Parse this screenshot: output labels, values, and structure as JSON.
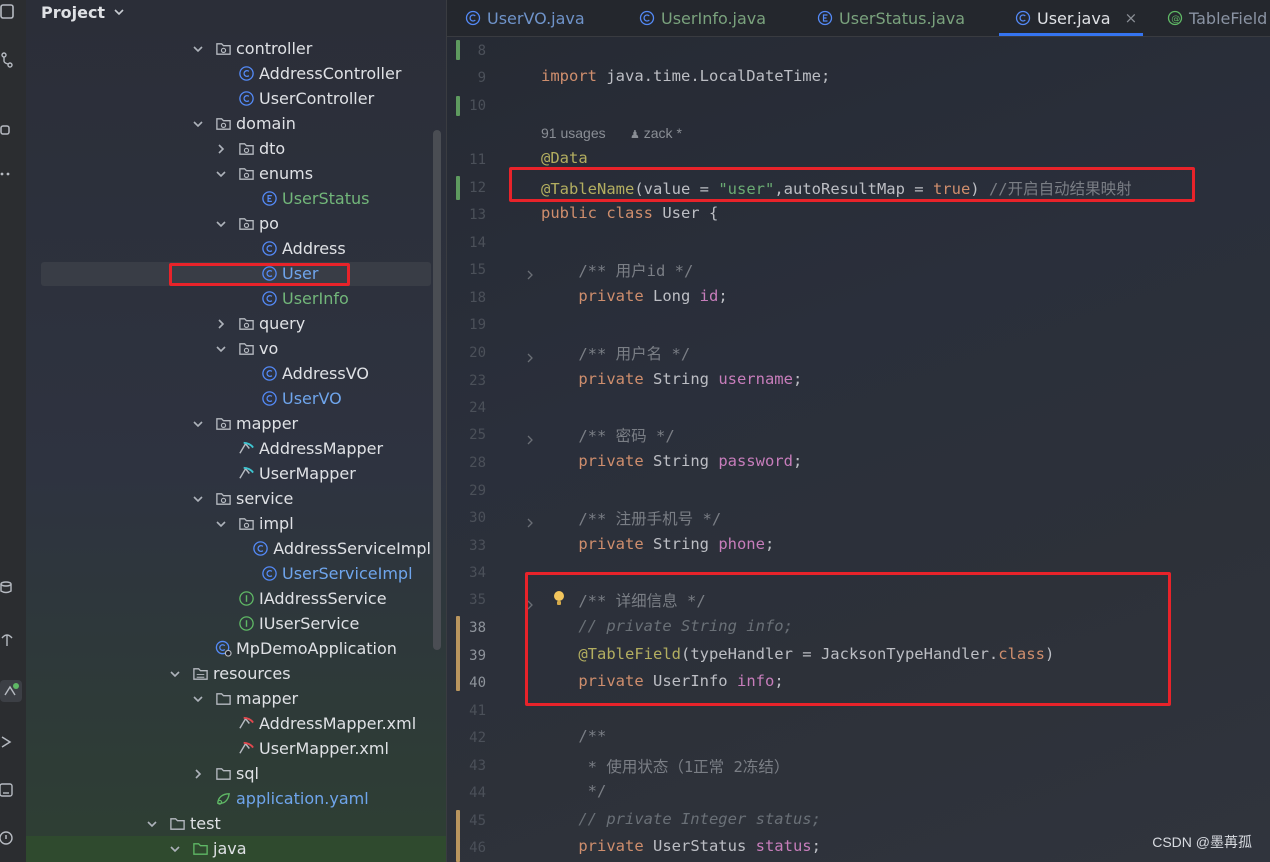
{
  "project_panel": {
    "title": "Project",
    "tree": [
      {
        "label": "controller",
        "kind": "folder",
        "expanded": true,
        "depth": 2,
        "color": "default"
      },
      {
        "label": "AddressController",
        "kind": "class",
        "depth": 3,
        "color": "default"
      },
      {
        "label": "UserController",
        "kind": "class",
        "depth": 3,
        "color": "default"
      },
      {
        "label": "domain",
        "kind": "folder",
        "expanded": true,
        "depth": 2,
        "color": "default"
      },
      {
        "label": "dto",
        "kind": "folder",
        "expanded": false,
        "depth": 3,
        "color": "default"
      },
      {
        "label": "enums",
        "kind": "folder",
        "expanded": true,
        "depth": 3,
        "color": "default"
      },
      {
        "label": "UserStatus",
        "kind": "enum",
        "depth": 4,
        "color": "green"
      },
      {
        "label": "po",
        "kind": "folder",
        "expanded": true,
        "depth": 3,
        "color": "default"
      },
      {
        "label": "Address",
        "kind": "class",
        "depth": 4,
        "color": "default"
      },
      {
        "label": "User",
        "kind": "class",
        "depth": 4,
        "color": "blue",
        "selected": true
      },
      {
        "label": "UserInfo",
        "kind": "class",
        "depth": 4,
        "color": "green"
      },
      {
        "label": "query",
        "kind": "folder",
        "expanded": false,
        "depth": 3,
        "color": "default"
      },
      {
        "label": "vo",
        "kind": "folder",
        "expanded": true,
        "depth": 3,
        "color": "default"
      },
      {
        "label": "AddressVO",
        "kind": "class",
        "depth": 4,
        "color": "default"
      },
      {
        "label": "UserVO",
        "kind": "class",
        "depth": 4,
        "color": "blue"
      },
      {
        "label": "mapper",
        "kind": "folder",
        "expanded": true,
        "depth": 2,
        "color": "default"
      },
      {
        "label": "AddressMapper",
        "kind": "mapper",
        "depth": 3,
        "color": "default"
      },
      {
        "label": "UserMapper",
        "kind": "mapper",
        "depth": 3,
        "color": "default"
      },
      {
        "label": "service",
        "kind": "folder",
        "expanded": true,
        "depth": 2,
        "color": "default"
      },
      {
        "label": "impl",
        "kind": "folder",
        "expanded": true,
        "depth": 3,
        "color": "default"
      },
      {
        "label": "AddressServiceImpl",
        "kind": "class",
        "depth": 4,
        "color": "default"
      },
      {
        "label": "UserServiceImpl",
        "kind": "class",
        "depth": 4,
        "color": "blue"
      },
      {
        "label": "IAddressService",
        "kind": "interface",
        "depth": 3,
        "color": "default"
      },
      {
        "label": "IUserService",
        "kind": "interface",
        "depth": 3,
        "color": "default"
      },
      {
        "label": "MpDemoApplication",
        "kind": "app",
        "depth": 2,
        "color": "default"
      },
      {
        "label": "resources",
        "kind": "resfolder",
        "expanded": true,
        "depth": 1,
        "color": "default"
      },
      {
        "label": "mapper",
        "kind": "plainfolder",
        "expanded": true,
        "depth": 2,
        "color": "default"
      },
      {
        "label": "AddressMapper.xml",
        "kind": "xml",
        "depth": 3,
        "color": "default"
      },
      {
        "label": "UserMapper.xml",
        "kind": "xml",
        "depth": 3,
        "color": "default"
      },
      {
        "label": "sql",
        "kind": "plainfolder",
        "expanded": false,
        "depth": 2,
        "color": "default"
      },
      {
        "label": "application.yaml",
        "kind": "yaml",
        "depth": 2,
        "color": "blue"
      },
      {
        "label": "test",
        "kind": "plainfolder",
        "expanded": true,
        "depth": 0,
        "color": "default"
      },
      {
        "label": "java",
        "kind": "srcfolder",
        "expanded": true,
        "depth": 1,
        "color": "default"
      }
    ]
  },
  "tabs": [
    {
      "label": "UserVO.java",
      "icon": "class-icon",
      "color": "blue"
    },
    {
      "label": "UserInfo.java",
      "icon": "class-icon",
      "color": "green"
    },
    {
      "label": "UserStatus.java",
      "icon": "enum-icon",
      "color": "green"
    },
    {
      "label": "User.java",
      "icon": "class-icon",
      "color": "active",
      "close": "×"
    },
    {
      "label": "TableField",
      "icon": "annotation-icon",
      "color": "default"
    }
  ],
  "editor": {
    "inlay_hint": {
      "usages": "91 usages",
      "author": "zack *"
    },
    "lines": [
      {
        "num": "8",
        "html": ""
      },
      {
        "num": "9",
        "html": "<span class='kw'>import</span> java.time.LocalDateTime;"
      },
      {
        "num": "10",
        "html": ""
      },
      {
        "num": "11",
        "html": "<span class='an'>@Data</span>"
      },
      {
        "num": "12",
        "html": "<span class='an'>@TableName</span>(value = <span class='str'>\"user\"</span>,autoResultMap = <span class='kw'>true</span>) <span class='cm'>//开启自动结果映射</span>"
      },
      {
        "num": "13",
        "html": "<span class='kw'>public class</span> User {"
      },
      {
        "num": "14",
        "html": ""
      },
      {
        "num": "15",
        "html": "    <span class='cm'>/** 用户id */</span>"
      },
      {
        "num": "18",
        "html": "    <span class='kw'>private</span> Long <span class='fld'>id</span>;"
      },
      {
        "num": "19",
        "html": ""
      },
      {
        "num": "20",
        "html": "    <span class='cm'>/** 用户名 */</span>"
      },
      {
        "num": "23",
        "html": "    <span class='kw'>private</span> String <span class='fld'>username</span>;"
      },
      {
        "num": "24",
        "html": ""
      },
      {
        "num": "25",
        "html": "    <span class='cm'>/** 密码 */</span>"
      },
      {
        "num": "28",
        "html": "    <span class='kw'>private</span> String <span class='fld'>password</span>;"
      },
      {
        "num": "29",
        "html": ""
      },
      {
        "num": "30",
        "html": "    <span class='cm'>/** 注册手机号 */</span>"
      },
      {
        "num": "33",
        "html": "    <span class='kw'>private</span> String <span class='fld'>phone</span>;"
      },
      {
        "num": "34",
        "html": ""
      },
      {
        "num": "35",
        "html": "    <span class='cm'>/** 详细信息 */</span>"
      },
      {
        "num": "38",
        "html": "    <span class='cmi'>// private String info;</span>"
      },
      {
        "num": "39",
        "html": "    <span class='an'>@TableField</span>(typeHandler = JacksonTypeHandler.<span class='kw'>class</span>)"
      },
      {
        "num": "40",
        "html": "    <span class='kw'>private</span> UserInfo <span class='fld'>info</span>;"
      },
      {
        "num": "41",
        "html": ""
      },
      {
        "num": "42",
        "html": "    <span class='cm'>/**</span>"
      },
      {
        "num": "43",
        "html": "<span class='cm'>     * 使用状态（1正常 2冻结）</span>"
      },
      {
        "num": "44",
        "html": "<span class='cm'>     */</span>"
      },
      {
        "num": "45",
        "html": "    <span class='cmi'>// private Integer status;</span>"
      },
      {
        "num": "46",
        "html": "    <span class='kw'>private</span> UserStatus <span class='fld'>status</span>;"
      }
    ]
  },
  "watermark": "CSDN @墨苒孤",
  "colors": {
    "highlight_box": "#e8232a",
    "accent": "#3574f0"
  }
}
